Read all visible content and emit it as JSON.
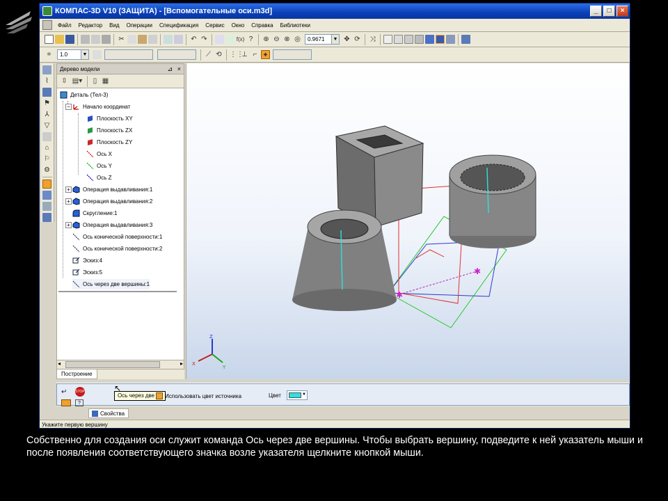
{
  "window": {
    "title": "КОМПАС-3D V10 (ЗАЩИТА) - [Вспомогательные оси.m3d]",
    "controls": [
      "_",
      "□",
      "×"
    ]
  },
  "menu": [
    "Файл",
    "Редактор",
    "Вид",
    "Операции",
    "Спецификация",
    "Сервис",
    "Окно",
    "Справка",
    "Библиотеки"
  ],
  "toolbar": {
    "zoom_value": "0.9671",
    "step_value": "1.0"
  },
  "tree": {
    "panel_title": "Дерево модели",
    "tab_label": "Построение",
    "items": [
      {
        "label": "Деталь (Тел-3)"
      },
      {
        "label": "Начало координат"
      },
      {
        "label": "Плоскость XY"
      },
      {
        "label": "Плоскость ZX"
      },
      {
        "label": "Плоскость ZY"
      },
      {
        "label": "Ось X"
      },
      {
        "label": "Ось Y"
      },
      {
        "label": "Ось Z"
      },
      {
        "label": "Операция выдавливания:1"
      },
      {
        "label": "Операция выдавливания:2"
      },
      {
        "label": "Скругление:1"
      },
      {
        "label": "Операция выдавливания:3"
      },
      {
        "label": "Ось конической поверхности:1"
      },
      {
        "label": "Ось конической поверхности:2"
      },
      {
        "label": "Эскиз:4"
      },
      {
        "label": "Эскиз:5"
      },
      {
        "label": "Ось через две вершины:1"
      }
    ]
  },
  "viewport": {
    "axes": {
      "x": "X",
      "y": "Y",
      "z": "Z"
    },
    "accent_color": "#2ee0e0"
  },
  "properties": {
    "tooltip": "Ось через две ве",
    "use_source_color_label": "Использовать цвет источника",
    "color_label": "Цвет",
    "color_value": "#2ee0e0",
    "tab_label": "Свойства"
  },
  "status": {
    "text": "Укажите первую вершину"
  },
  "caption": "Собственно для создания оси служит команда Ось через две вершины. Чтобы выбрать вершину, подведите к ней указатель мыши и после появления соответствующего значка возле указателя щелкните кнопкой мыши."
}
